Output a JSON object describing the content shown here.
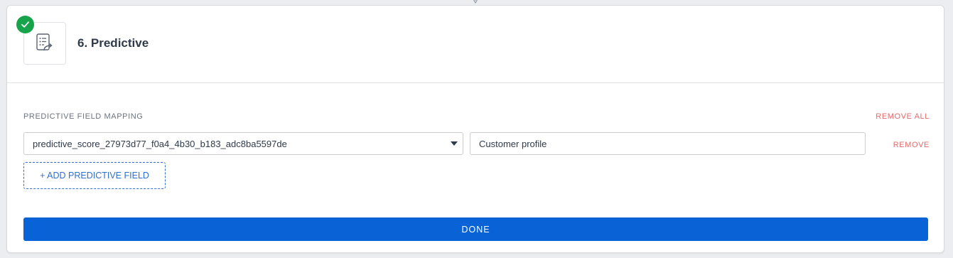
{
  "step": {
    "title": "6. Predictive",
    "icon": "predictive-document-icon",
    "status_icon": "check-icon",
    "status_color": "#17a34a"
  },
  "mapping": {
    "section_label": "PREDICTIVE FIELD MAPPING",
    "remove_all_label": "REMOVE ALL",
    "rows": [
      {
        "field_value": "predictive_score_27973d77_f0a4_4b30_b183_adc8ba5597de",
        "target_value": "Customer profile",
        "remove_label": "REMOVE"
      }
    ],
    "add_button_label": "+ ADD PREDICTIVE FIELD"
  },
  "actions": {
    "done_label": "DONE",
    "done_color": "#0a63d6"
  },
  "colors": {
    "danger": "#e56a6a",
    "link": "#2f6fd1"
  }
}
